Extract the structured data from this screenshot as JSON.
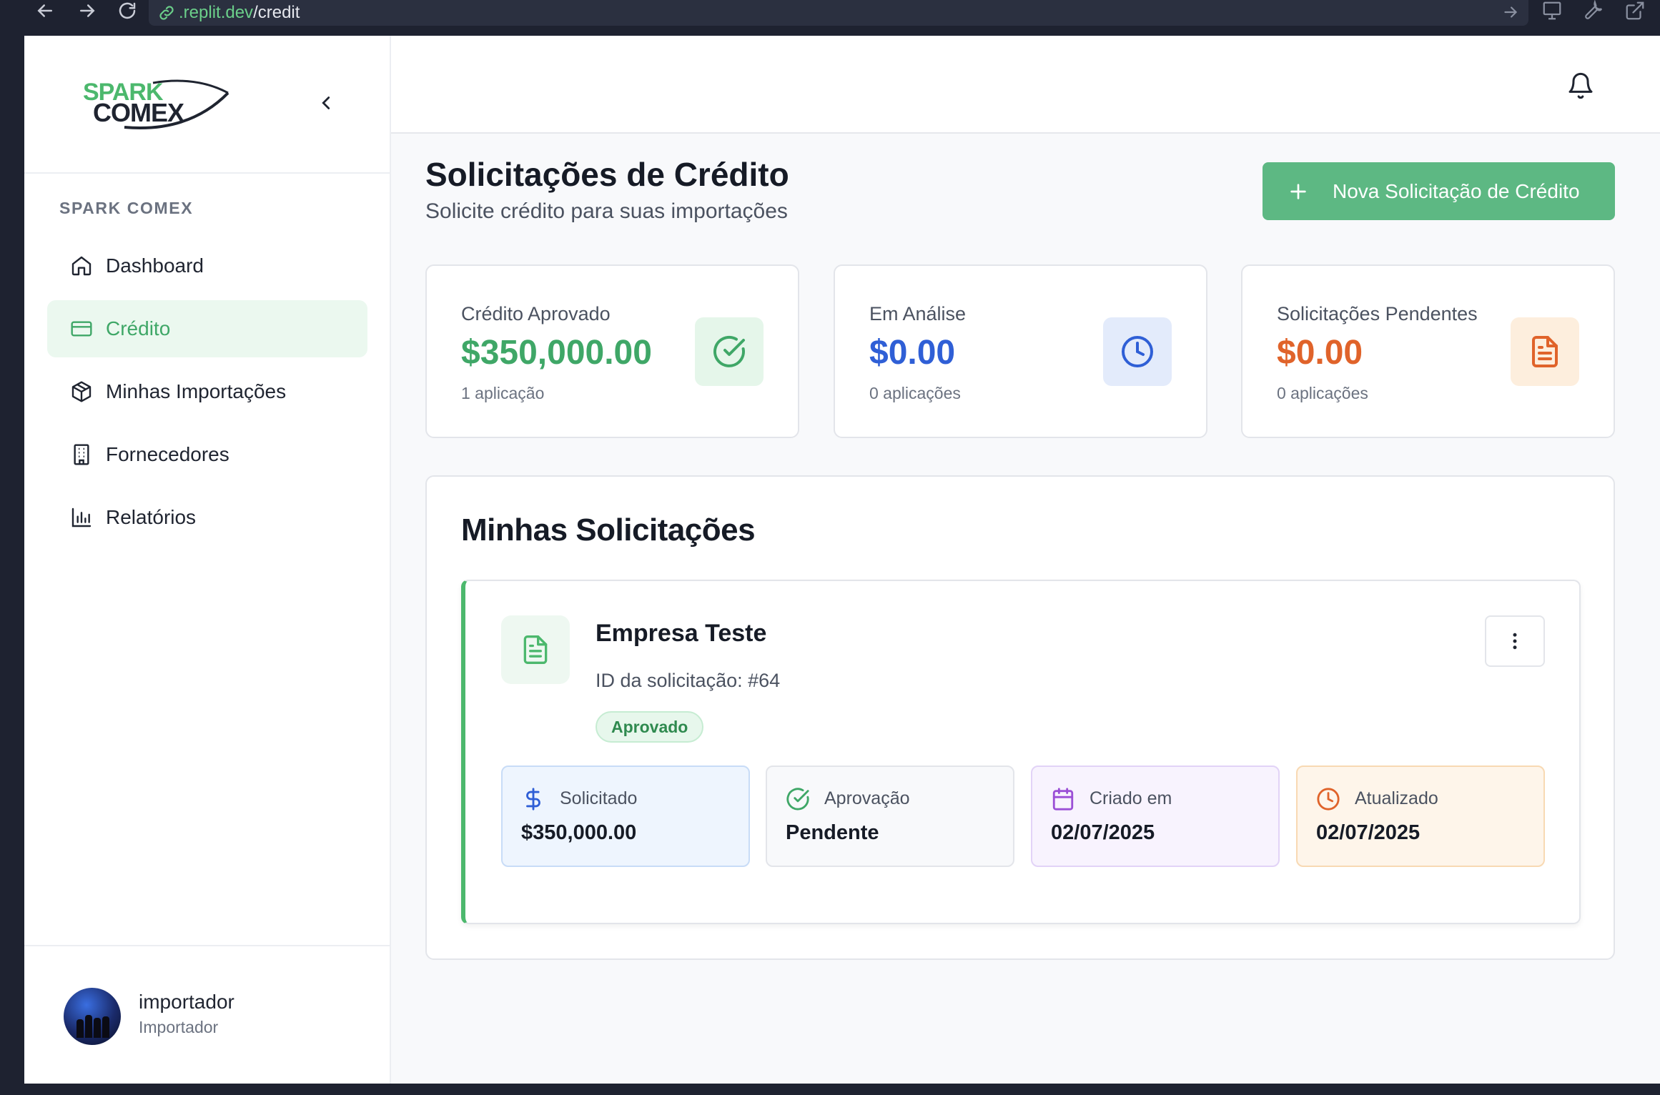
{
  "browser": {
    "url_host": ".replit.dev",
    "url_path": "/credit"
  },
  "sidebar": {
    "logo_line1": "SPARK",
    "logo_line2": "COMEX",
    "section_label": "SPARK COMEX",
    "items": [
      {
        "label": "Dashboard",
        "icon": "home-icon",
        "active": false
      },
      {
        "label": "Crédito",
        "icon": "credit-card-icon",
        "active": true
      },
      {
        "label": "Minhas Importações",
        "icon": "package-icon",
        "active": false
      },
      {
        "label": "Fornecedores",
        "icon": "building-icon",
        "active": false
      },
      {
        "label": "Relatórios",
        "icon": "bar-chart-icon",
        "active": false
      }
    ],
    "user": {
      "name": "importador",
      "role": "Importador"
    }
  },
  "page": {
    "title": "Solicitações de Crédito",
    "subtitle": "Solicite crédito para suas importações",
    "new_button_label": "Nova Solicitação de Crédito"
  },
  "stats": [
    {
      "label": "Crédito Aprovado",
      "value": "$350,000.00",
      "count": "1 aplicação",
      "icon": "check-circle-icon",
      "color": "#3fa767"
    },
    {
      "label": "Em Análise",
      "value": "$0.00",
      "count": "0 aplicações",
      "icon": "clock-icon",
      "color": "#2f5fd6"
    },
    {
      "label": "Solicitações Pendentes",
      "value": "$0.00",
      "count": "0 aplicações",
      "icon": "file-text-icon",
      "color": "#e0632a"
    }
  ],
  "requests_panel": {
    "title": "Minhas Solicitações",
    "card": {
      "company": "Empresa Teste",
      "request_id": "ID da solicitação: #64",
      "status": "Aprovado",
      "details": [
        {
          "label": "Solicitado",
          "value": "$350,000.00",
          "icon": "dollar-icon"
        },
        {
          "label": "Aprovação",
          "value": "Pendente",
          "icon": "check-circle-icon"
        },
        {
          "label": "Criado em",
          "value": "02/07/2025",
          "icon": "calendar-icon"
        },
        {
          "label": "Atualizado",
          "value": "02/07/2025",
          "icon": "clock-icon"
        }
      ]
    }
  },
  "colors": {
    "accent_green": "#5db883",
    "active_bg": "#ebf8ef",
    "blue": "#2f5fd6",
    "orange": "#e0632a",
    "purple": "#9b4fd6"
  }
}
